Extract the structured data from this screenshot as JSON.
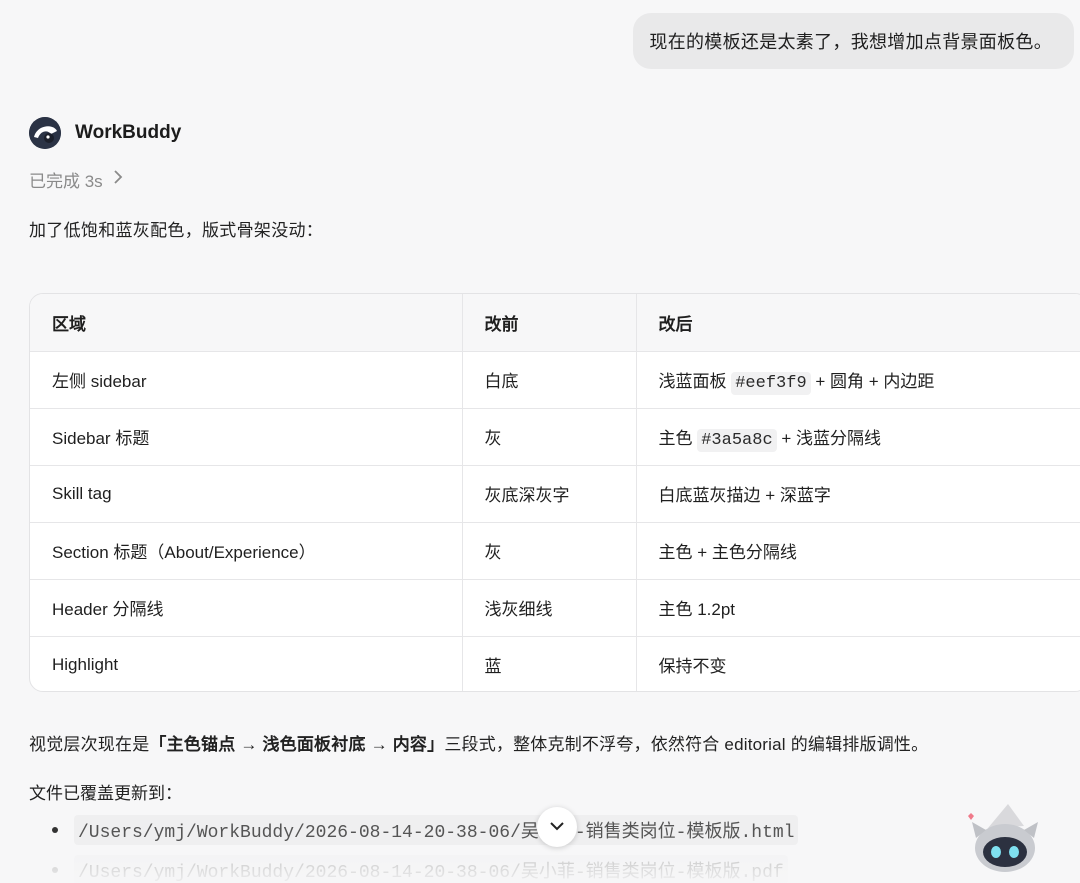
{
  "user_message": "现在的模板还是太素了，我想增加点背景面板色。",
  "agent": {
    "name": "WorkBuddy",
    "status": "已完成 3s"
  },
  "intro": "加了低饱和蓝灰配色，版式骨架没动：",
  "table": {
    "headers": [
      "区域",
      "改前",
      "改后"
    ],
    "rows": [
      {
        "area": "左侧 sidebar",
        "before": "白底",
        "after_pre": "浅蓝面板 ",
        "after_code": "#eef3f9",
        "after_post": " + 圆角 + 内边距"
      },
      {
        "area": "Sidebar 标题",
        "before": "灰",
        "after_pre": "主色 ",
        "after_code": "#3a5a8c",
        "after_post": " + 浅蓝分隔线"
      },
      {
        "area": "Skill tag",
        "before": "灰底深灰字",
        "after_pre": "白底蓝灰描边 + 深蓝字",
        "after_code": "",
        "after_post": ""
      },
      {
        "area": "Section 标题（About/Experience）",
        "before": "灰",
        "after_pre": "主色 + 主色分隔线",
        "after_code": "",
        "after_post": ""
      },
      {
        "area": "Header 分隔线",
        "before": "浅灰细线",
        "after_pre": "主色 1.2pt",
        "after_code": "",
        "after_post": ""
      },
      {
        "area": "Highlight",
        "before": "蓝",
        "after_pre": "保持不变",
        "after_code": "",
        "after_post": ""
      }
    ]
  },
  "summary": {
    "pre": "视觉层次现在是",
    "bold": "「主色锚点 → 浅色面板衬底 → 内容」",
    "post": "三段式，整体克制不浮夸，依然符合 editorial 的编辑排版调性。"
  },
  "files_title": "文件已覆盖更新到：",
  "files": [
    "/Users/ymj/WorkBuddy/2026-08-14-20-38-06/吴小菲-销售类岗位-模板版.html",
    "/Users/ymj/WorkBuddy/2026-08-14-20-38-06/吴小菲-销售类岗位-模板版.pdf"
  ],
  "icons": {
    "status_chevron": "chevron-right-icon",
    "scroll": "chevron-down-icon",
    "avatar": "workbuddy-avatar-icon",
    "mascot": "robot-cat-mascot-icon"
  }
}
